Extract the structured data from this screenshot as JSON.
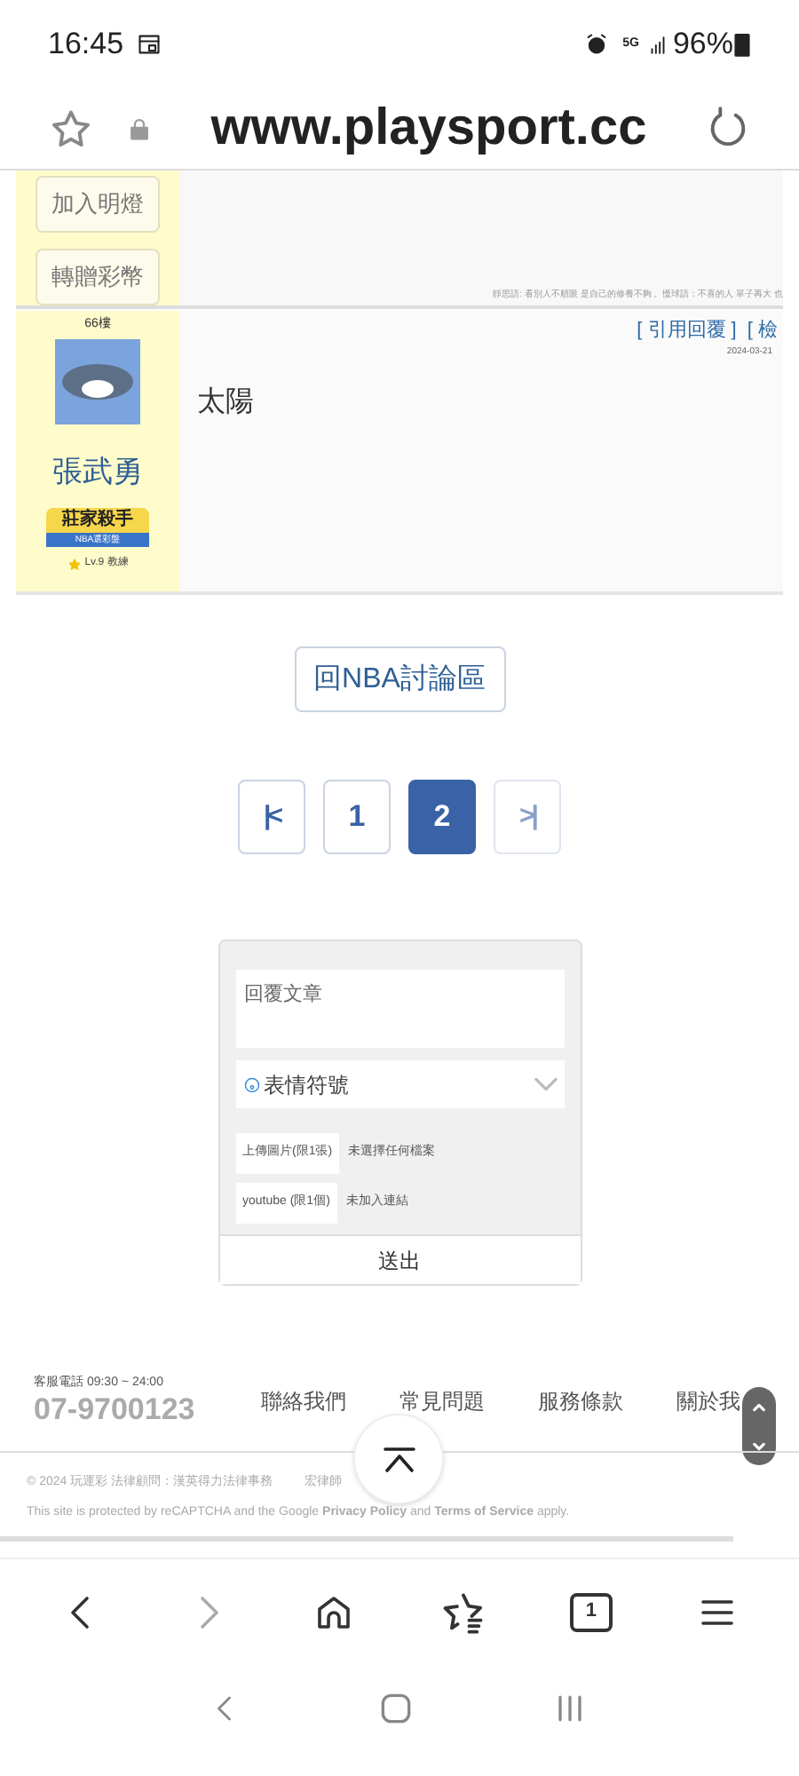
{
  "status_bar": {
    "time": "16:45",
    "network": "5G",
    "battery": "96%"
  },
  "address_bar": {
    "url": "www.playsport.cc"
  },
  "prev_post": {
    "buttons": [
      "加入明燈",
      "轉贈彩幣"
    ],
    "signature": "靜思語: 看別人不順眼 是自己的修養不夠 。慢球語：不喜的人 單子再大 也"
  },
  "post": {
    "floor": "66樓",
    "author": "張武勇",
    "badge_title": "莊家殺手",
    "badge_subtitle": "NBA選彩盤",
    "level": "Lv.9 教練",
    "actions": [
      "[ 引用回覆 ]",
      "[ 檢"
    ],
    "date": "2024-03-21",
    "body": "太陽"
  },
  "back_button": "回NBA討論區",
  "pagination": [
    {
      "kind": "first",
      "label": "|<",
      "selected": false,
      "disabled": false
    },
    {
      "kind": "page",
      "label": "1",
      "selected": false,
      "disabled": false
    },
    {
      "kind": "page",
      "label": "2",
      "selected": true,
      "disabled": false
    },
    {
      "kind": "last",
      "label": ">|",
      "selected": false,
      "disabled": true
    }
  ],
  "reply_form": {
    "placeholder": "回覆文章",
    "emoji_select": "表情符號",
    "upload_image": "上傳圖片(限1張)",
    "upload_status": "未選擇任何檔案",
    "youtube": "youtube (限1個)",
    "youtube_status": "未加入連結",
    "submit": "送出"
  },
  "footer": {
    "hotline_label": "客服電話 09:30 ~ 24:00",
    "phone": "07-9700123",
    "links": [
      "聯絡我們",
      "常見問題",
      "服務條款",
      "關於我"
    ],
    "copyright_left": "© 2024 玩運彩 法律顧問：漢英得力法律事務",
    "copyright_right": "宏律師",
    "recaptcha": "This site is protected by reCAPTCHA and the Google **Privacy Policy** and **Terms of Service** apply."
  },
  "browser_toolbar": {
    "tab_count": "1"
  }
}
